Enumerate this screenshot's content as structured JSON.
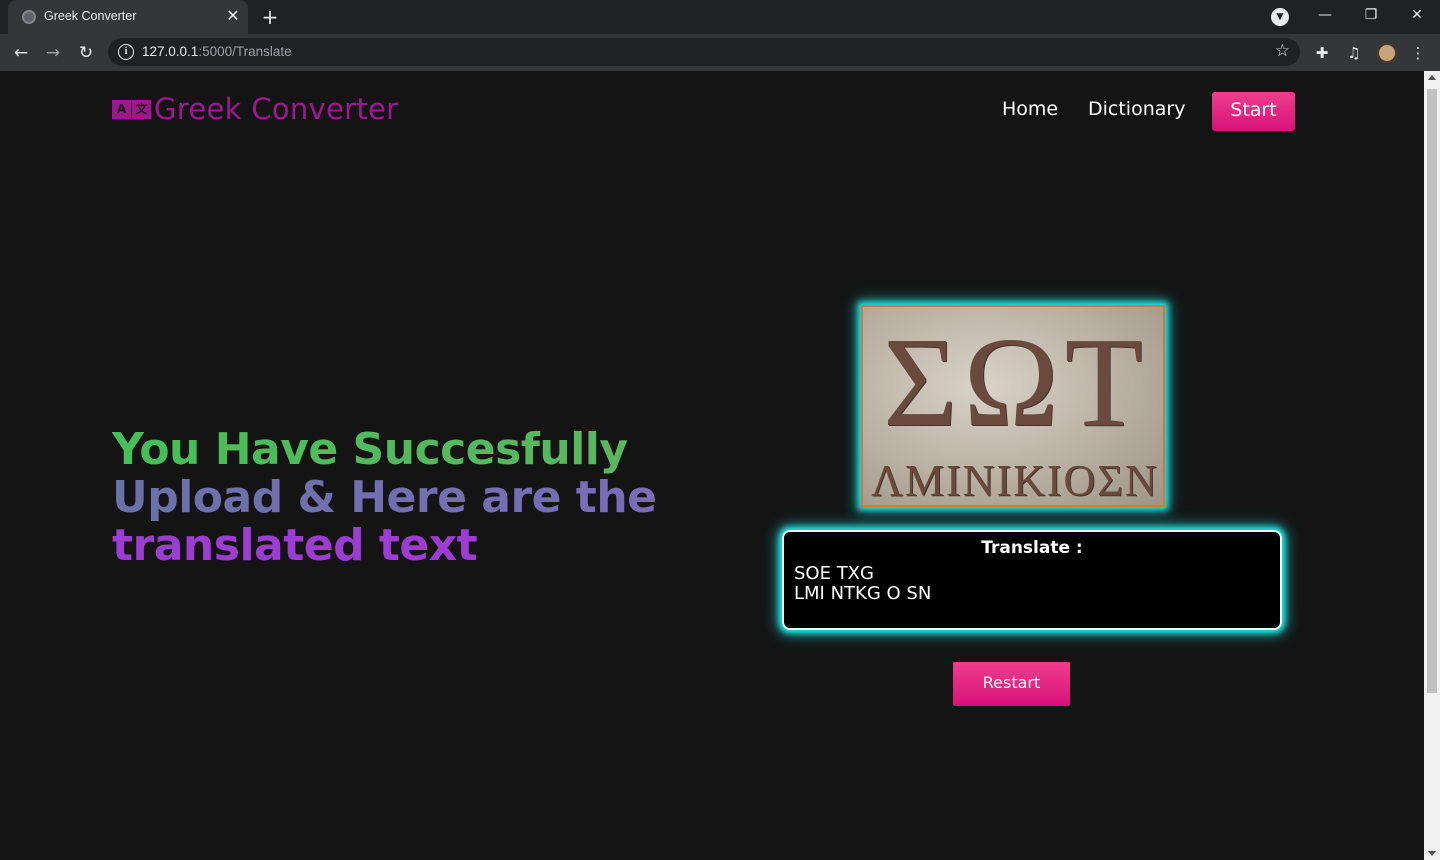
{
  "browser": {
    "tab_title": "Greek Converter",
    "url_host": "127.0.0.1",
    "url_rest": ":5000/Translate"
  },
  "site": {
    "logo_mark_letters": [
      "A",
      "文"
    ],
    "logo_text": "Greek Converter",
    "nav": {
      "home": "Home",
      "dictionary": "Dictionary",
      "start": "Start"
    }
  },
  "main": {
    "headline": {
      "line1": "You Have Succesfully",
      "line2": "Upload & Here are the",
      "line3": "translated text"
    },
    "uploaded_image": {
      "big_text": "ΣΩΤ",
      "small_text": "ΛΜΙΝΙΚΙΟΣΝ"
    },
    "result": {
      "label": "Translate :",
      "lines": [
        "SOE TXG",
        "LMI NTKG O SN"
      ]
    },
    "restart_label": "Restart"
  },
  "colors": {
    "brand": "#a01590",
    "button": "#e0177f",
    "glow": "#22e6e6",
    "headline_green": "#45bf57",
    "headline_slate": "#6a72a8",
    "headline_purple": "#9b3dd1"
  }
}
